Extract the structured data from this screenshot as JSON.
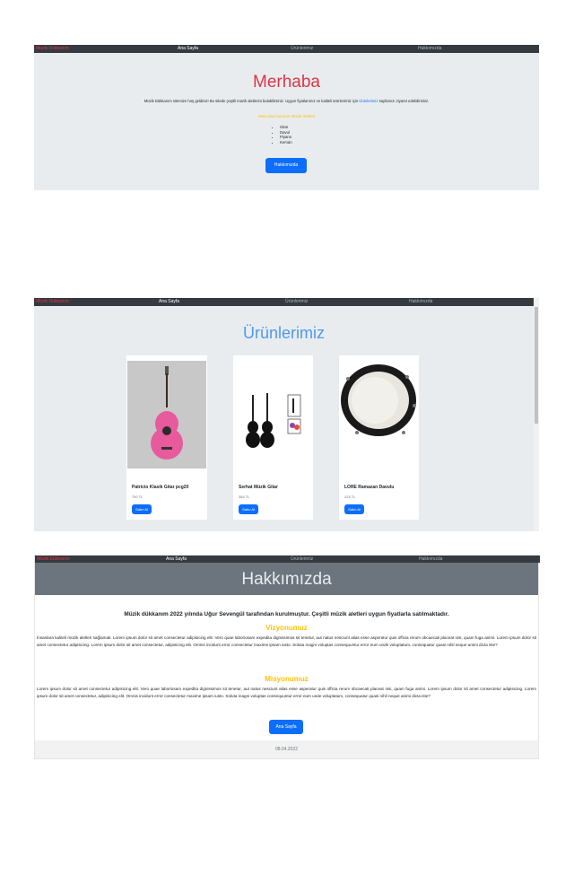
{
  "nav": {
    "brand": "Müzik Dükkanım",
    "home": "Ana Sayfa",
    "products": "Ürünlerimiz",
    "about": "Hakkımızda"
  },
  "home": {
    "title": "Merhaba",
    "intro_prefix": "Müzik Dükkanım sitemize hoş geldiniz! Bu sitede çeşitli müzik aletlerini bulabilirsiniz. Uygun fiyatlarımız ve kaliteli ürünlerimiz için",
    "intro_link": "Ürünlerimiz",
    "intro_suffix": "sayfamızı ziyaret edebilirsiniz.",
    "list_title": "Mevcutta bulunan Müzik Aletleri",
    "items": [
      "Gitar",
      "Davul",
      "Piyano",
      "Keman"
    ],
    "button": "Hakkımızda"
  },
  "products": {
    "title": "Ürünlerimiz",
    "cards": [
      {
        "name": "Patricio Klasik Gitar pcg20",
        "price": "750 TL",
        "button": "Satın Al",
        "image": "pink-classical-guitar"
      },
      {
        "name": "Serhat Müzik Gitar",
        "price": "384 TL",
        "button": "Satın Al",
        "image": "black-guitars"
      },
      {
        "name": "LORE Ramazan Davulu",
        "price": "425 TL",
        "button": "Satın Al",
        "image": "ramadan-drum"
      }
    ]
  },
  "about": {
    "title": "Hakkımızda",
    "lead": "Müzik dükkanım 2022 yılında Uğur Sevengül tarafından kurulmuştur. Çeşitli müzik aletleri uygun fiyatlarla satılmaktadır.",
    "vision_title": "Vizyonumuz",
    "vision_text": "İnsanlara kaliteli müzik aletleri sağlamak. Lorem ipsum dolor sit amet consectetur adipisicing elit. Vero quae laboriosam expedita dignissimos sit tenetur, aut natus nesciunt alias esse asperatur quis officia rerum obcaecati placeat nisi, quam fuga animi. Lorem ipsum dolor sit amet consectetur adipisicing. Lorem ipsum dolor sit amet consectetur, adipisicing elit. Omnis incidunt error consectetur maxime ipsam iusto. Soluta magni voluptas consequuntur error eum unde voluptatum, consequatur quasi nihil neque animi dicta iste?",
    "mission_title": "Misyonumuz",
    "mission_text": "Lorem ipsum dolor sit amet consectetur adipisicing elit. Vero quae laboriosam expedita dignissimos sit tenetur, aut natus nesciunt alias esse asperatur quis officia rerum obcaecati placeat nisi, quam fuga animi. Lorem ipsum dolor sit amet consectetur adipisicing. Lorem ipsum dolor sit amet consectetur, adipisicing elit. Omnis incidunt error consectetur maxime ipsam iusto. Soluta magni voluptas consequuntur error eum unde voluptatum, consequatur quasi nihil neque animi dicta iste?",
    "button": "Ana Sayfa",
    "footer_date": "08.04.2022"
  },
  "colors": {
    "brand": "#dc3545",
    "nav_bg": "#343a40",
    "jumbotron": "#e9ecef",
    "primary": "#0d6efd",
    "warning": "#ffc107",
    "products_title": "#4d9be8",
    "about_header": "#6c757d"
  }
}
